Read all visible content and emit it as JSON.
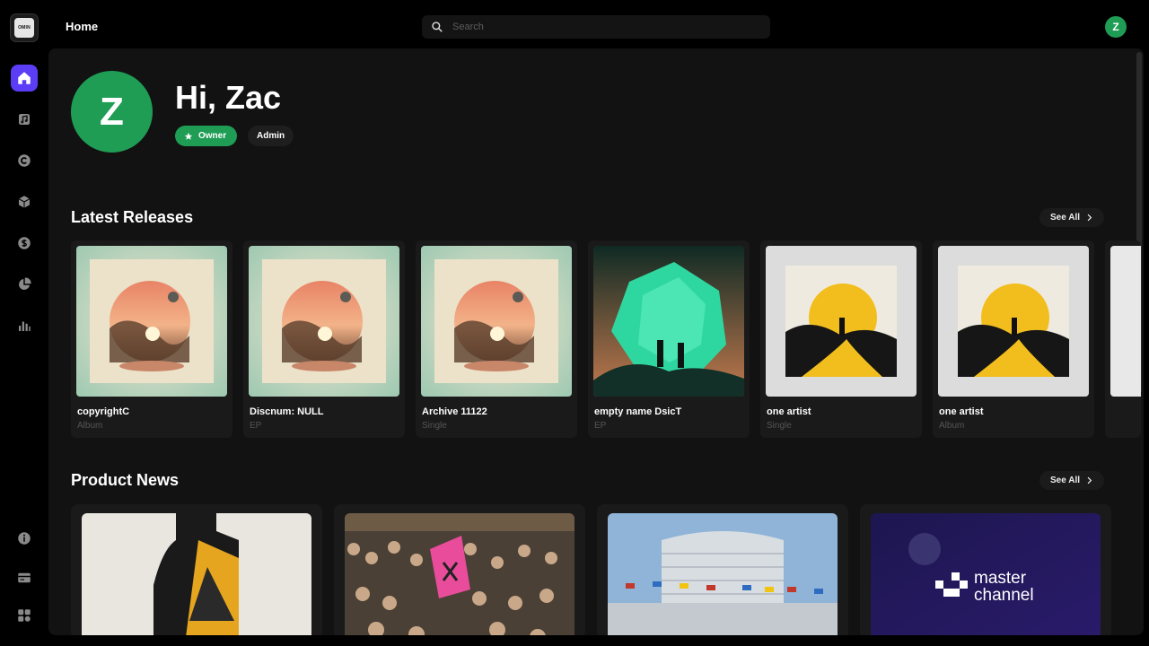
{
  "app": {
    "logo_text": "OMIN"
  },
  "header": {
    "title": "Home",
    "search_placeholder": "Search",
    "avatar_initial": "Z"
  },
  "sidebar": {
    "items": [
      {
        "name": "home",
        "icon": "home-icon",
        "active": true
      },
      {
        "name": "releases",
        "icon": "music-note-icon"
      },
      {
        "name": "copyright",
        "icon": "copyright-icon"
      },
      {
        "name": "products",
        "icon": "cube-icon"
      },
      {
        "name": "finance",
        "icon": "dollar-icon"
      },
      {
        "name": "analytics-pie",
        "icon": "pie-chart-icon"
      },
      {
        "name": "analytics-bars",
        "icon": "bar-chart-icon"
      }
    ],
    "bottom": [
      {
        "name": "info",
        "icon": "info-icon"
      },
      {
        "name": "billing",
        "icon": "card-icon"
      },
      {
        "name": "apps",
        "icon": "apps-icon"
      }
    ]
  },
  "profile": {
    "avatar_initial": "Z",
    "greeting": "Hi, Zac",
    "owner_badge": "Owner",
    "admin_badge": "Admin"
  },
  "latest_releases": {
    "title": "Latest Releases",
    "see_all": "See All",
    "items": [
      {
        "title": "copyrightC",
        "type": "Album",
        "art": "moon"
      },
      {
        "title": "Discnum: NULL",
        "type": "EP",
        "art": "moon"
      },
      {
        "title": "Archive 11122",
        "type": "Single",
        "art": "moon"
      },
      {
        "title": "empty name DsicT",
        "type": "EP",
        "art": "crystal"
      },
      {
        "title": "one artist",
        "type": "Single",
        "art": "sun"
      },
      {
        "title": "one artist",
        "type": "Album",
        "art": "sun"
      }
    ]
  },
  "product_news": {
    "title": "Product News",
    "see_all": "See All",
    "items": [
      {
        "image": "silhouette-collage"
      },
      {
        "image": "protest-crowd"
      },
      {
        "image": "building-flags"
      },
      {
        "image": "master-channel",
        "overlay_line1": "master",
        "overlay_line2": "channel"
      }
    ]
  },
  "colors": {
    "accent": "#5b3df5",
    "owner_green": "#1f9d55",
    "panel": "#121212",
    "card": "#1a1a1a"
  }
}
